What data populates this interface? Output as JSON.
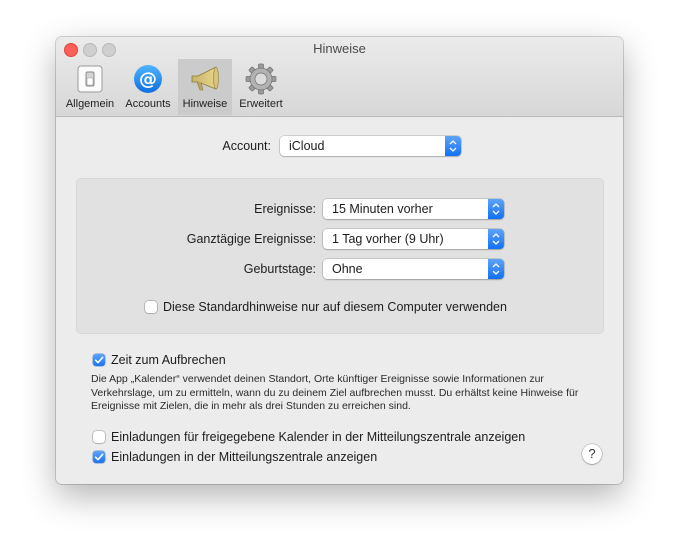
{
  "window": {
    "title": "Hinweise"
  },
  "toolbar": {
    "tabs": [
      {
        "label": "Allgemein",
        "icon": "switch-icon"
      },
      {
        "label": "Accounts",
        "icon": "at-icon"
      },
      {
        "label": "Hinweise",
        "icon": "megaphone-icon",
        "active": true
      },
      {
        "label": "Erweitert",
        "icon": "gear-icon"
      }
    ]
  },
  "account": {
    "label": "Account:",
    "value": "iCloud"
  },
  "defaults": {
    "events": {
      "label": "Ereignisse:",
      "value": "15 Minuten vorher"
    },
    "allday": {
      "label": "Ganztägige Ereignisse:",
      "value": "1 Tag vorher (9 Uhr)"
    },
    "birthdays": {
      "label": "Geburtstage:",
      "value": "Ohne"
    },
    "local_only": {
      "label": "Diese Standardhinweise nur auf diesem Computer verwenden",
      "checked": false
    }
  },
  "travel": {
    "label": "Zeit zum Aufbrechen",
    "checked": true,
    "description": "Die App „Kalender“ verwendet deinen Standort, Orte künftiger Ereignisse sowie Informationen zur Verkehrslage, um zu ermitteln, wann du zu deinem Ziel aufbrechen musst. Du erhältst keine Hinweise für Ereignisse mit Zielen, die in mehr als drei Stunden zu erreichen sind."
  },
  "shared_invites": {
    "label": "Einladungen für freigegebene Kalender in der Mitteilungszentrale anzeigen",
    "checked": false
  },
  "invites": {
    "label": "Einladungen in der Mitteilungszentrale anzeigen",
    "checked": true
  },
  "help": {
    "label": "?"
  },
  "colors": {
    "accent": "#1c74f2",
    "close": "#fe5f57"
  }
}
